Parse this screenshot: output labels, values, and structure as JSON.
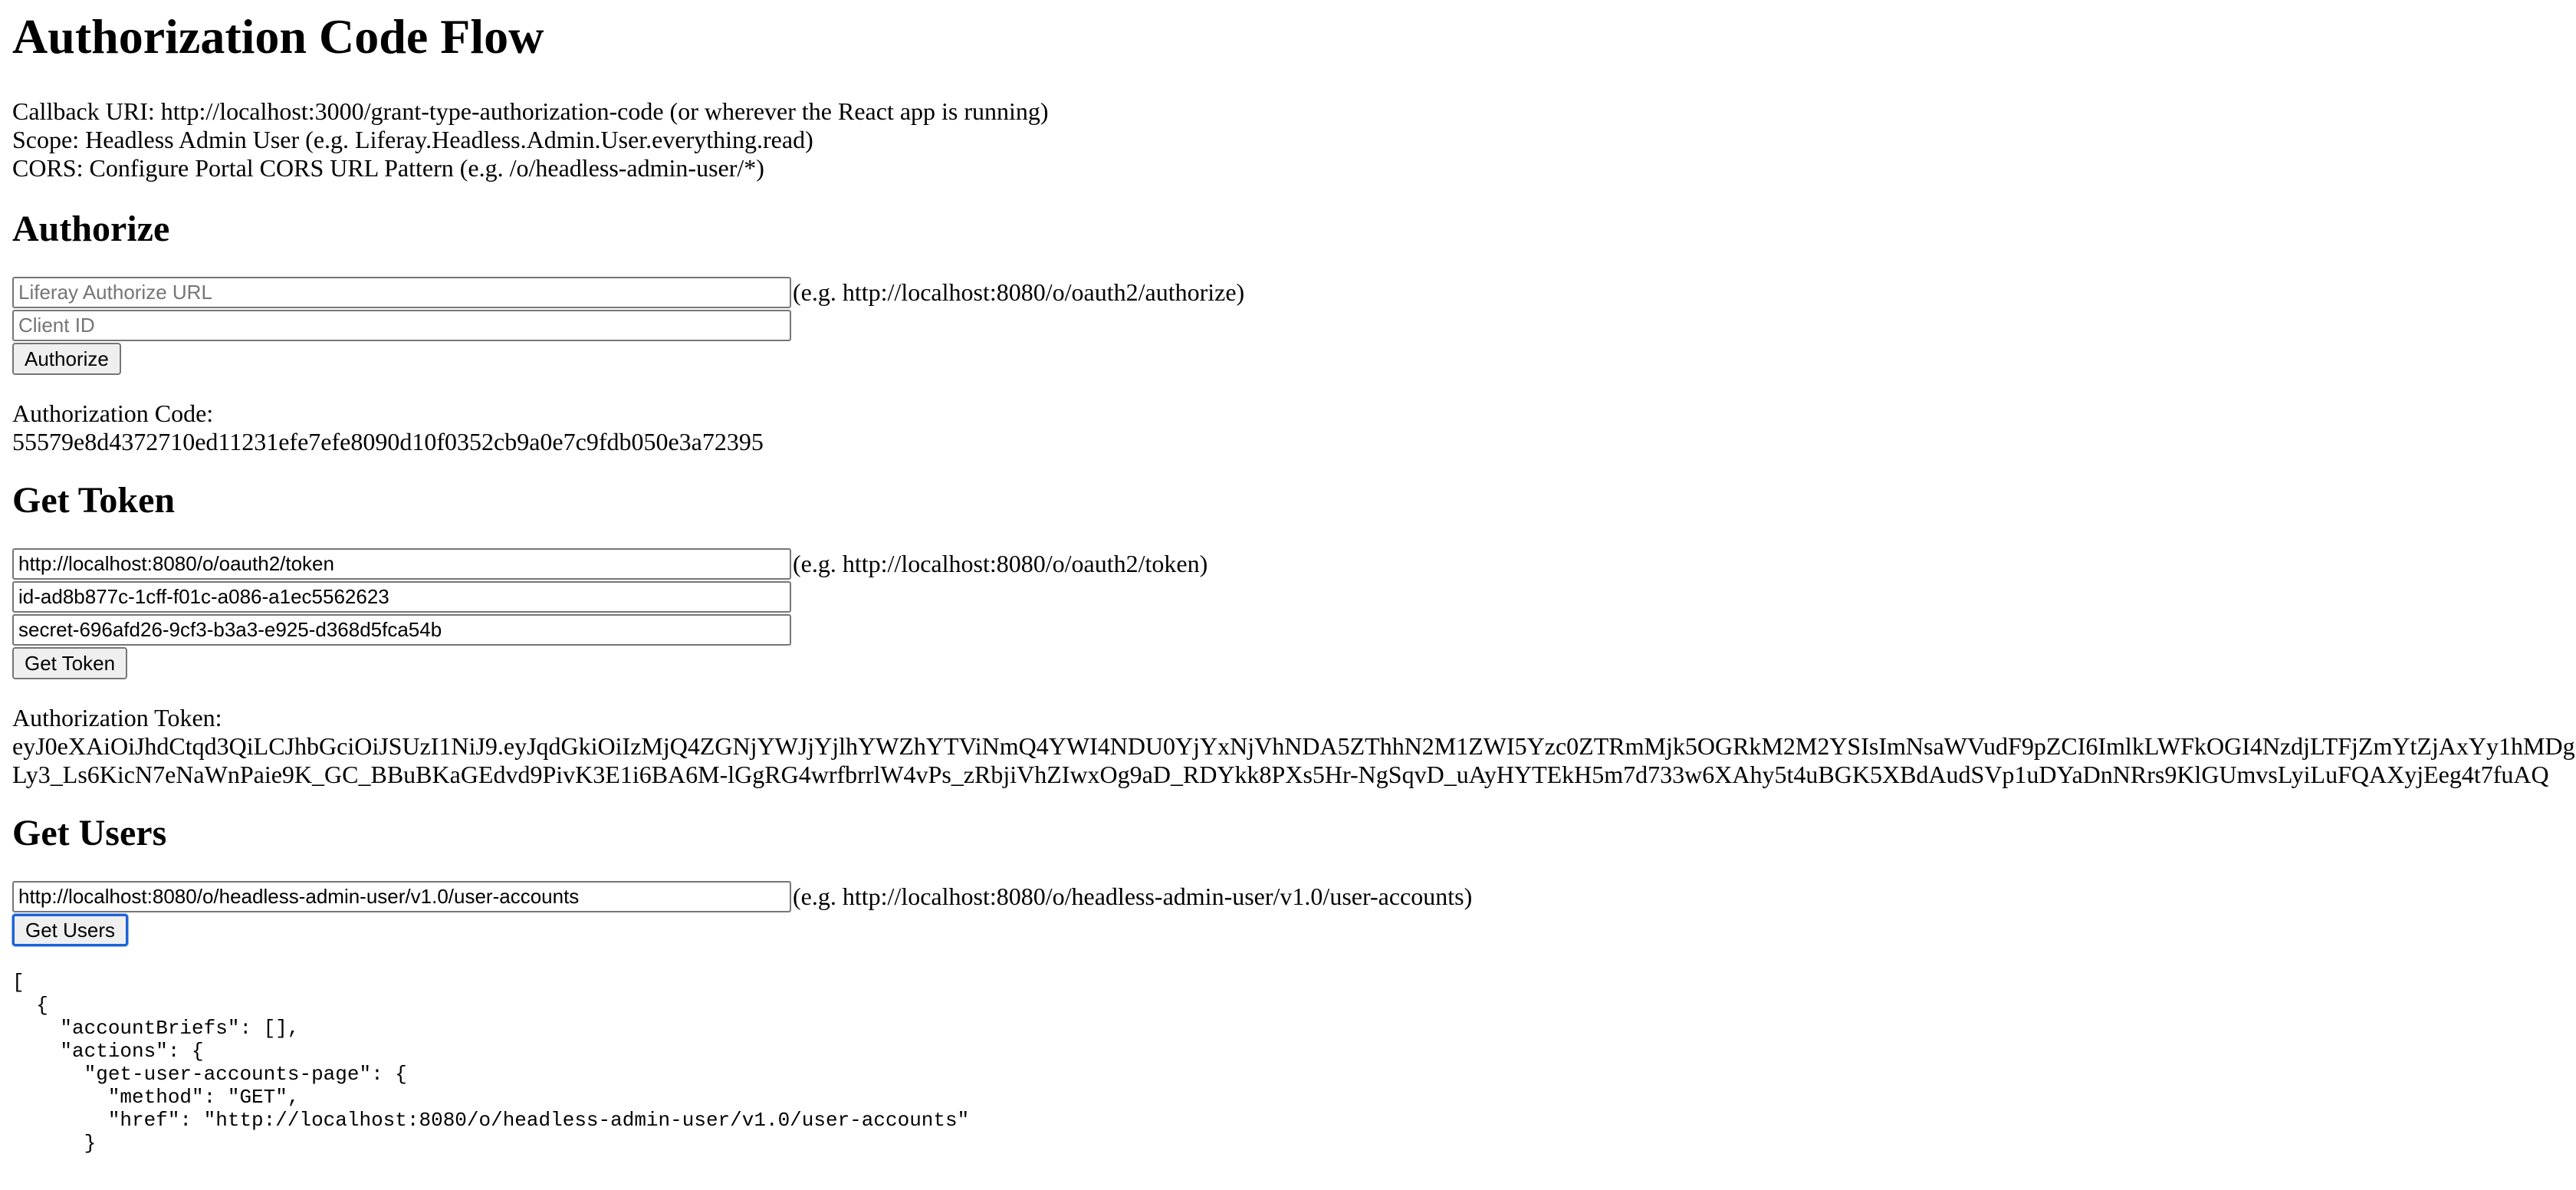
{
  "page": {
    "title": "Authorization Code Flow"
  },
  "intro": {
    "callback": "Callback URI: http://localhost:3000/grant-type-authorization-code (or wherever the React app is running)",
    "scope": "Scope: Headless Admin User (e.g. Liferay.Headless.Admin.User.everything.read)",
    "cors": "CORS: Configure Portal CORS URL Pattern (e.g. /o/headless-admin-user/*)"
  },
  "authorize": {
    "heading": "Authorize",
    "url_value": "",
    "url_placeholder": "Liferay Authorize URL",
    "url_hint": "(e.g. http://localhost:8080/o/oauth2/authorize)",
    "client_id_value": "",
    "client_id_placeholder": "Client ID",
    "button_label": "Authorize",
    "code_label": "Authorization Code:",
    "code_value": "55579e8d4372710ed11231efe7efe8090d10f0352cb9a0e7c9fdb050e3a72395"
  },
  "token": {
    "heading": "Get Token",
    "url_value": "http://localhost:8080/o/oauth2/token",
    "url_hint": "(e.g. http://localhost:8080/o/oauth2/token)",
    "client_id_value": "id-ad8b877c-1cff-f01c-a086-a1ec5562623",
    "client_secret_value": "secret-696afd26-9cf3-b3a3-e925-d368d5fca54b",
    "button_label": "Get Token",
    "token_label": "Authorization Token:",
    "token_line1": "eyJ0eXAiOiJhdCtqd3QiLCJhbGciOiJSUzI1NiJ9.eyJqdGkiOiIzMjQ4ZGNjYWJjYjlhYWZhYTViNmQ4YWI4NDU0YjYxNjVhNDA5ZThhN2M1ZWI5Yzc0ZTRmMjk5OGRkM2M2YSIsImNsaWVudF9pZCI6ImlkLWFkOGI4NzdjLTFjZmYtZjAxYy1hMDg",
    "token_line2": "Ly3_Ls6KicN7eNaWnPaie9K_GC_BBuBKaGEdvd9PivK3E1i6BA6M-lGgRG4wrfbrrlW4vPs_zRbjiVhZIwxOg9aD_RDYkk8PXs5Hr-NgSqvD_uAyHYTEkH5m7d733w6XAhy5t4uBGK5XBdAudSVp1uDYaDnNRrs9KlGUmvsLyiLuFQAXyjEeg4t7fuAQ"
  },
  "users": {
    "heading": "Get Users",
    "url_value": "http://localhost:8080/o/headless-admin-user/v1.0/user-accounts",
    "url_hint": "(e.g. http://localhost:8080/o/headless-admin-user/v1.0/user-accounts)",
    "button_label": "Get Users",
    "response_json": "[\n  {\n    \"accountBriefs\": [],\n    \"actions\": {\n      \"get-user-accounts-page\": {\n        \"method\": \"GET\",\n        \"href\": \"http://localhost:8080/o/headless-admin-user/v1.0/user-accounts\"\n      }"
  }
}
